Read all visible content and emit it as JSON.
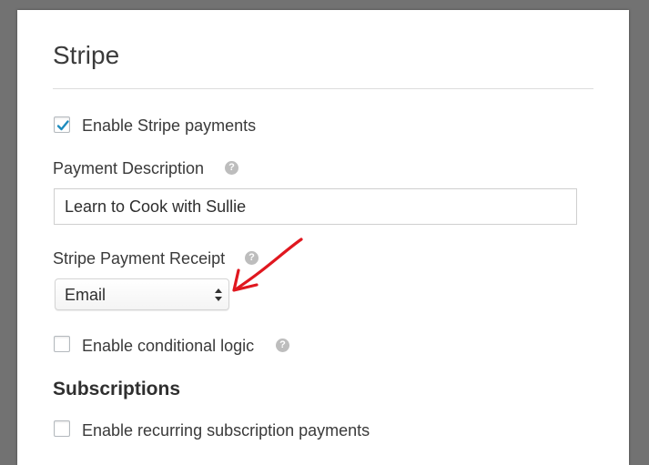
{
  "panel": {
    "title": "Stripe",
    "enable_stripe": {
      "label": "Enable Stripe payments",
      "checked": true
    },
    "payment_description": {
      "label": "Payment Description",
      "value": "Learn to Cook with Sullie",
      "help_icon": "question-mark-circle"
    },
    "payment_receipt": {
      "label": "Stripe Payment Receipt",
      "selected": "Email",
      "help_icon": "question-mark-circle"
    },
    "conditional_logic": {
      "label": "Enable conditional logic",
      "checked": false,
      "help_icon": "question-mark-circle"
    },
    "subscriptions": {
      "heading": "Subscriptions",
      "recurring": {
        "label": "Enable recurring subscription payments",
        "checked": false
      }
    }
  },
  "colors": {
    "check_mark": "#1e8cbe",
    "annotation_arrow": "#e0171f",
    "background": "#727272"
  },
  "annotation": {
    "icon": "red-arrow-pointing-to-select"
  }
}
